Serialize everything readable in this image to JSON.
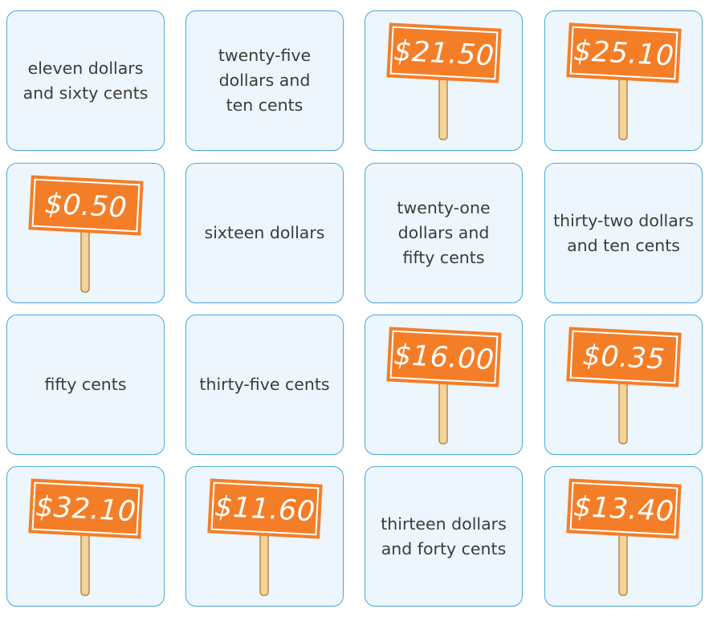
{
  "colors": {
    "card_background": "#eef6fd",
    "card_border": "#4aa8d8",
    "sign_orange": "#f47e27",
    "sign_inner_border": "#ffffff",
    "stick": "#f3d49b",
    "stick_outline": "#b9864a",
    "text": "#3b3b3b"
  },
  "cards": [
    {
      "type": "words",
      "text": "eleven dollars\nand sixty cents"
    },
    {
      "type": "words",
      "text": "twenty-five\ndollars and\nten cents"
    },
    {
      "type": "price",
      "icon": "price-sign-icon",
      "price": "$21.50"
    },
    {
      "type": "price",
      "icon": "price-sign-icon",
      "price": "$25.10"
    },
    {
      "type": "price",
      "icon": "price-sign-icon",
      "price": "$0.50"
    },
    {
      "type": "words",
      "text": "sixteen dollars"
    },
    {
      "type": "words",
      "text": "twenty-one\ndollars and\nfifty cents"
    },
    {
      "type": "words",
      "text": "thirty-two dollars\nand ten cents"
    },
    {
      "type": "words",
      "text": "fifty cents"
    },
    {
      "type": "words",
      "text": "thirty-five cents"
    },
    {
      "type": "price",
      "icon": "price-sign-icon",
      "price": "$16.00"
    },
    {
      "type": "price",
      "icon": "price-sign-icon",
      "price": "$0.35"
    },
    {
      "type": "price",
      "icon": "price-sign-icon",
      "price": "$32.10"
    },
    {
      "type": "price",
      "icon": "price-sign-icon",
      "price": "$11.60"
    },
    {
      "type": "words",
      "text": "thirteen dollars\nand forty cents"
    },
    {
      "type": "price",
      "icon": "price-sign-icon",
      "price": "$13.40"
    }
  ]
}
